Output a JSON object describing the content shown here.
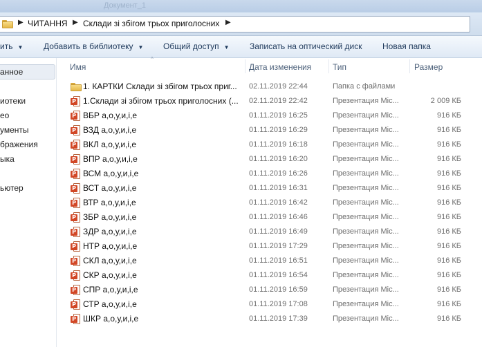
{
  "window": {
    "ghost_title": "Документ_1"
  },
  "address": {
    "crumbs": [
      "ЧИТАННЯ",
      "Склади зі збігом трьох приголосних"
    ],
    "arrow": "▶"
  },
  "toolbar": {
    "organize": "ить",
    "add_to_library": "Добавить в библиотеку",
    "share": "Общий доступ",
    "burn": "Записать на оптический диск",
    "new_folder": "Новая папка",
    "caret": "▼"
  },
  "nav": {
    "items": [
      "анное",
      "иотеки",
      "ео",
      "ументы",
      "бражения",
      "ыка",
      "ьютер"
    ]
  },
  "columns": {
    "name": "Имя",
    "date": "Дата изменения",
    "type": "Тип",
    "size": "Размер",
    "sort": "^"
  },
  "files": [
    {
      "icon": "folder-icon",
      "name": "1. КАРТКИ Склади зі збігом трьох приг...",
      "date": "02.11.2019 22:44",
      "type": "Папка с файлами",
      "size": ""
    },
    {
      "icon": "powerpoint-icon",
      "name": "1.Склади зі збігом трьох приголосних (...",
      "date": "02.11.2019 22:42",
      "type": "Презентация Mic...",
      "size": "2 009 КБ"
    },
    {
      "icon": "powerpoint-icon",
      "name": "ВБР а,о,у,и,і,е",
      "date": "01.11.2019 16:25",
      "type": "Презентация Mic...",
      "size": "916 КБ"
    },
    {
      "icon": "powerpoint-icon",
      "name": "ВЗД а,о,у,и,і,е",
      "date": "01.11.2019 16:29",
      "type": "Презентация Mic...",
      "size": "916 КБ"
    },
    {
      "icon": "powerpoint-icon",
      "name": "ВКЛ а,о,у,и,і,е",
      "date": "01.11.2019 16:18",
      "type": "Презентация Mic...",
      "size": "916 КБ"
    },
    {
      "icon": "powerpoint-icon",
      "name": "ВПР а,о,у,и,і,е",
      "date": "01.11.2019 16:20",
      "type": "Презентация Mic...",
      "size": "916 КБ"
    },
    {
      "icon": "powerpoint-icon",
      "name": "ВСМ а,о,у,и,і,е",
      "date": "01.11.2019 16:26",
      "type": "Презентация Mic...",
      "size": "916 КБ"
    },
    {
      "icon": "powerpoint-icon",
      "name": "ВСТ а,о,у,и,і,е",
      "date": "01.11.2019 16:31",
      "type": "Презентация Mic...",
      "size": "916 КБ"
    },
    {
      "icon": "powerpoint-icon",
      "name": "ВТР а,о,у,и,і,е",
      "date": "01.11.2019 16:42",
      "type": "Презентация Mic...",
      "size": "916 КБ"
    },
    {
      "icon": "powerpoint-icon",
      "name": "ЗБР а,о,у,и,і,е",
      "date": "01.11.2019 16:46",
      "type": "Презентация Mic...",
      "size": "916 КБ"
    },
    {
      "icon": "powerpoint-icon",
      "name": "ЗДР а,о,у,и,і,е",
      "date": "01.11.2019 16:49",
      "type": "Презентация Mic...",
      "size": "916 КБ"
    },
    {
      "icon": "powerpoint-icon",
      "name": "НТР а,о,у,и,і,е",
      "date": "01.11.2019 17:29",
      "type": "Презентация Mic...",
      "size": "916 КБ"
    },
    {
      "icon": "powerpoint-icon",
      "name": "СКЛ а,о,у,и,і,е",
      "date": "01.11.2019 16:51",
      "type": "Презентация Mic...",
      "size": "916 КБ"
    },
    {
      "icon": "powerpoint-icon",
      "name": "СКР а,о,у,и,і,е",
      "date": "01.11.2019 16:54",
      "type": "Презентация Mic...",
      "size": "916 КБ"
    },
    {
      "icon": "powerpoint-icon",
      "name": "СПР а,о,у,и,і,е",
      "date": "01.11.2019 16:59",
      "type": "Презентация Mic...",
      "size": "916 КБ"
    },
    {
      "icon": "powerpoint-icon",
      "name": "СТР а,о,у,и,і,е",
      "date": "01.11.2019 17:08",
      "type": "Презентация Mic...",
      "size": "916 КБ"
    },
    {
      "icon": "powerpoint-icon",
      "name": "ШКР а,о,у,и,і,е",
      "date": "01.11.2019 17:39",
      "type": "Презентация Mic...",
      "size": "916 КБ"
    }
  ]
}
